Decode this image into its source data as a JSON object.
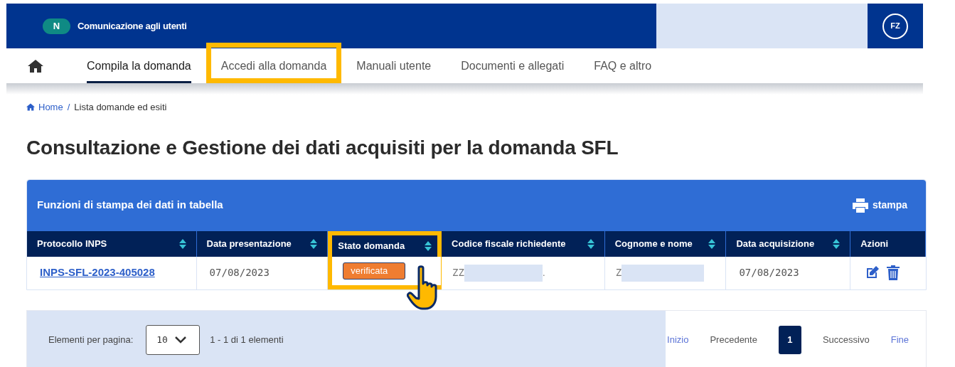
{
  "top_bar": {
    "badge": "N",
    "notice": "Comunicazione agli utenti",
    "user_initials": "FZ"
  },
  "nav": {
    "tabs": [
      {
        "label": "Compila la domanda",
        "selected": true,
        "highlighted": false
      },
      {
        "label": "Accedi alla domanda",
        "selected": false,
        "highlighted": true
      },
      {
        "label": "Manuali utente",
        "selected": false,
        "highlighted": false
      },
      {
        "label": "Documenti e allegati",
        "selected": false,
        "highlighted": false
      },
      {
        "label": "FAQ e altro",
        "selected": false,
        "highlighted": false
      }
    ]
  },
  "breadcrumb": {
    "items": [
      "Home",
      "Lista domande ed esiti"
    ],
    "separator": "/"
  },
  "title": "Consultazione e Gestione dei dati acquisiti per la domanda SFL",
  "table": {
    "caption": "Funzioni di stampa dei dati in tabella",
    "print_label": "stampa",
    "columns": [
      {
        "label": "Protocollo INPS",
        "sortable": true,
        "highlighted": false
      },
      {
        "label": "Data presentazione",
        "sortable": true,
        "highlighted": false
      },
      {
        "label": "Stato domanda",
        "sortable": true,
        "highlighted": true
      },
      {
        "label": "Codice fiscale richiedente",
        "sortable": true,
        "highlighted": false
      },
      {
        "label": "Cognome e nome",
        "sortable": true,
        "highlighted": false
      },
      {
        "label": "Data acquisizione",
        "sortable": true,
        "highlighted": false
      },
      {
        "label": "Azioni",
        "sortable": false,
        "highlighted": false
      }
    ],
    "rows": [
      {
        "protocollo": "INPS-SFL-2023-405028",
        "data_presentazione": "07/08/2023",
        "stato": "verificata",
        "codice_fiscale": "ZZ",
        "codice_fiscale_end": ".",
        "cognome_nome": "Z",
        "data_acquisizione": "07/08/2023"
      }
    ]
  },
  "pagination": {
    "per_page_label": "Elementi per pagina:",
    "per_page": "10",
    "range": "1 - 1 di 1 elementi",
    "links": [
      {
        "label": "Inizio",
        "kind": "link",
        "selected": false
      },
      {
        "label": "Precedente",
        "kind": "text",
        "selected": false
      },
      {
        "label": "1",
        "kind": "page",
        "selected": true
      },
      {
        "label": "Successivo",
        "kind": "text",
        "selected": false
      },
      {
        "label": "Fine",
        "kind": "link",
        "selected": false
      }
    ]
  }
}
